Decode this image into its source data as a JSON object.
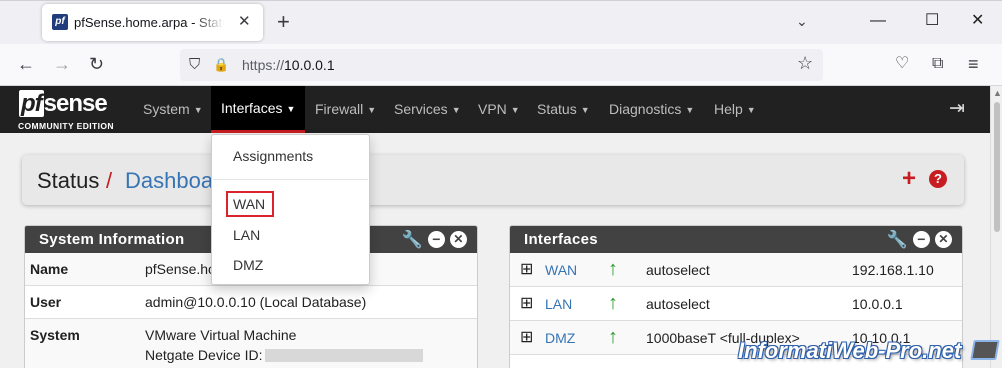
{
  "browser": {
    "tab_title": "pfSense.home.arpa - Status: Dashboard",
    "favicon_text": "pf",
    "close_tab_glyph": "✕",
    "new_tab_glyph": "+",
    "tabs_menu_glyph": "⌄",
    "minimize_glyph": "—",
    "maximize_glyph": "☐",
    "close_window_glyph": "✕",
    "back_glyph": "←",
    "forward_glyph": "→",
    "reload_glyph": "↻",
    "url_protocol": "https://",
    "url_host": "10.0.0.1",
    "shield_glyph": "⛉",
    "lock_glyph": "🔒",
    "bookmark_glyph": "☆",
    "pocket_glyph": "♡",
    "extensions_glyph": "⧉",
    "app_menu_glyph": "≡",
    "scroll_up_glyph": "▲"
  },
  "pfsense": {
    "brand_pf": "pf",
    "brand_sense": "sense",
    "brand_edition": "COMMUNITY EDITION",
    "menu": [
      {
        "label": "System"
      },
      {
        "label": "Interfaces"
      },
      {
        "label": "Firewall"
      },
      {
        "label": "Services"
      },
      {
        "label": "VPN"
      },
      {
        "label": "Status"
      },
      {
        "label": "Diagnostics"
      },
      {
        "label": "Help"
      }
    ],
    "caret": "▼",
    "logout_glyph": "⇥",
    "active_menu": "Interfaces",
    "dropdown_items": [
      "Assignments",
      "WAN",
      "LAN",
      "DMZ"
    ],
    "highlighted_item": "WAN",
    "highlight_color": "#d9232d"
  },
  "breadcrumb": {
    "status": "Status",
    "separator": "/",
    "page": "Dashboard",
    "add_glyph": "+",
    "help_glyph": "?"
  },
  "system_info": {
    "title": "System Information",
    "wrench_glyph": "🔧",
    "minimize_glyph": "−",
    "close_glyph": "✕",
    "rows": [
      {
        "label": "Name",
        "value": "pfSense.home.arpa"
      },
      {
        "label": "User",
        "value": "admin@10.0.0.10 (Local Database)"
      },
      {
        "label": "System",
        "value": "VMware Virtual Machine",
        "value2": "Netgate Device ID:"
      }
    ]
  },
  "interfaces": {
    "title": "Interfaces",
    "net_glyph": "⊞",
    "up_glyph": "↑",
    "status_color": "#2a9c2a",
    "rows": [
      {
        "name": "WAN",
        "media": "autoselect",
        "ip": "192.168.1.10"
      },
      {
        "name": "LAN",
        "media": "autoselect",
        "ip": "10.0.0.1"
      },
      {
        "name": "DMZ",
        "media": "1000baseT <full-duplex>",
        "ip": "10.10.0.1"
      }
    ]
  },
  "watermark": "InformatiWeb-Pro.net",
  "colors": {
    "nav_bg": "#212121",
    "accent_red": "#c71c22",
    "link_blue": "#3774b4",
    "panel_header": "#424242"
  }
}
